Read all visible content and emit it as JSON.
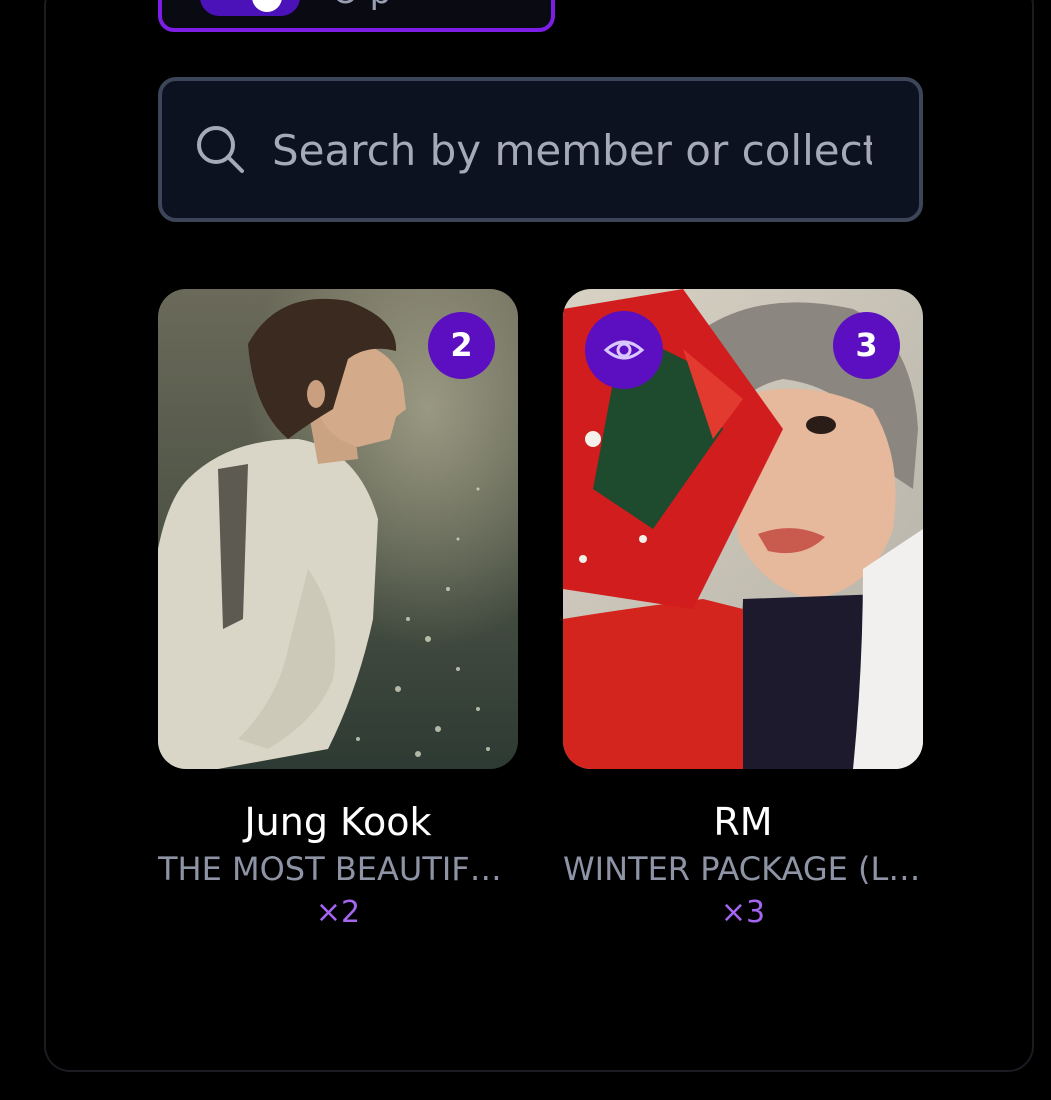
{
  "filter": {
    "toggle_label": "O p"
  },
  "search": {
    "placeholder": "Search by member or collecti"
  },
  "cards": [
    {
      "member": "Jung Kook",
      "collection": "THE MOST BEAUTIFUL...",
      "count": "2",
      "quantity": "×2",
      "image": "jung-kook-photocard"
    },
    {
      "member": "RM",
      "collection": "WINTER PACKAGE (LE...",
      "count": "3",
      "quantity": "×3",
      "image": "rm-photocard",
      "icon": "eye-icon"
    }
  ],
  "colors": {
    "accent": "#5b0fc0",
    "accent_text": "#a466f0",
    "border": "#7c1ee6"
  }
}
